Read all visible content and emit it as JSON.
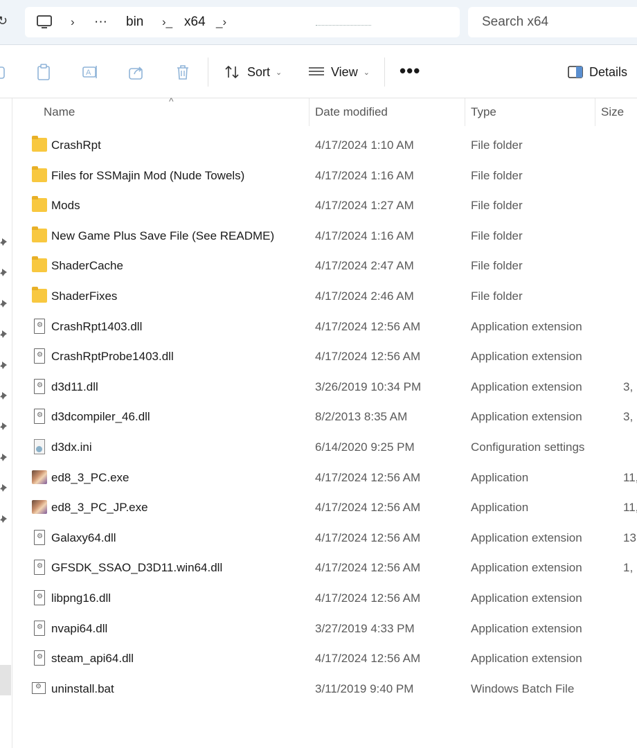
{
  "address": {
    "crumbs": [
      "bin",
      "x64"
    ],
    "overflow_label": "···",
    "separator": "›"
  },
  "search": {
    "placeholder": "Search x64"
  },
  "commandbar": {
    "sort_label": "Sort",
    "view_label": "View",
    "more_label": "•••",
    "details_label": "Details"
  },
  "columns": {
    "name": "Name",
    "date": "Date modified",
    "type": "Type",
    "size": "Size"
  },
  "files": [
    {
      "name": "CrashRpt",
      "date": "4/17/2024 1:10 AM",
      "type": "File folder",
      "size": "",
      "icon": "folder-icon"
    },
    {
      "name": "Files for SSMajin Mod (Nude Towels)",
      "date": "4/17/2024 1:16 AM",
      "type": "File folder",
      "size": "",
      "icon": "folder-icon"
    },
    {
      "name": "Mods",
      "date": "4/17/2024 1:27 AM",
      "type": "File folder",
      "size": "",
      "icon": "folder-icon"
    },
    {
      "name": "New Game Plus Save File (See README)",
      "date": "4/17/2024 1:16 AM",
      "type": "File folder",
      "size": "",
      "icon": "folder-icon"
    },
    {
      "name": "ShaderCache",
      "date": "4/17/2024 2:47 AM",
      "type": "File folder",
      "size": "",
      "icon": "folder-icon"
    },
    {
      "name": "ShaderFixes",
      "date": "4/17/2024 2:46 AM",
      "type": "File folder",
      "size": "",
      "icon": "folder-icon"
    },
    {
      "name": "CrashRpt1403.dll",
      "date": "4/17/2024 12:56 AM",
      "type": "Application extension",
      "size": "",
      "icon": "dll-file-icon"
    },
    {
      "name": "CrashRptProbe1403.dll",
      "date": "4/17/2024 12:56 AM",
      "type": "Application extension",
      "size": "",
      "icon": "dll-file-icon"
    },
    {
      "name": "d3d11.dll",
      "date": "3/26/2019 10:34 PM",
      "type": "Application extension",
      "size": "3,",
      "icon": "dll-file-icon"
    },
    {
      "name": "d3dcompiler_46.dll",
      "date": "8/2/2013 8:35 AM",
      "type": "Application extension",
      "size": "3,",
      "icon": "dll-file-icon"
    },
    {
      "name": "d3dx.ini",
      "date": "6/14/2020 9:25 PM",
      "type": "Configuration settings",
      "size": "",
      "icon": "ini-file-icon"
    },
    {
      "name": "ed8_3_PC.exe",
      "date": "4/17/2024 12:56 AM",
      "type": "Application",
      "size": "11,",
      "icon": "exe-app-icon"
    },
    {
      "name": "ed8_3_PC_JP.exe",
      "date": "4/17/2024 12:56 AM",
      "type": "Application",
      "size": "11,",
      "icon": "exe-app-icon"
    },
    {
      "name": "Galaxy64.dll",
      "date": "4/17/2024 12:56 AM",
      "type": "Application extension",
      "size": "13,",
      "icon": "dll-file-icon"
    },
    {
      "name": "GFSDK_SSAO_D3D11.win64.dll",
      "date": "4/17/2024 12:56 AM",
      "type": "Application extension",
      "size": "1,",
      "icon": "dll-file-icon"
    },
    {
      "name": "libpng16.dll",
      "date": "4/17/2024 12:56 AM",
      "type": "Application extension",
      "size": "",
      "icon": "dll-file-icon"
    },
    {
      "name": "nvapi64.dll",
      "date": "3/27/2019 4:33 PM",
      "type": "Application extension",
      "size": "",
      "icon": "dll-file-icon"
    },
    {
      "name": "steam_api64.dll",
      "date": "4/17/2024 12:56 AM",
      "type": "Application extension",
      "size": "",
      "icon": "dll-file-icon"
    },
    {
      "name": "uninstall.bat",
      "date": "3/11/2019 9:40 PM",
      "type": "Windows Batch File",
      "size": "",
      "icon": "bat-file-icon"
    }
  ]
}
